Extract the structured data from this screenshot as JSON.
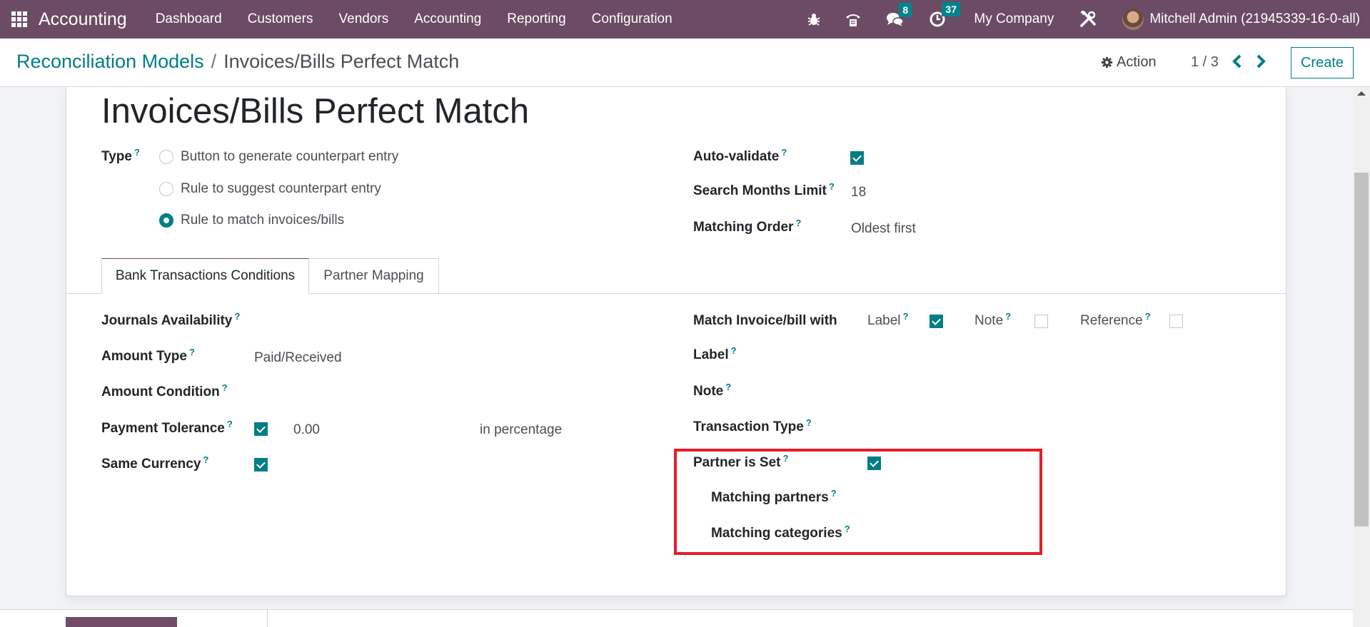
{
  "navbar": {
    "app_name": "Accounting",
    "menu": [
      "Dashboard",
      "Customers",
      "Vendors",
      "Accounting",
      "Reporting",
      "Configuration"
    ],
    "messages_count": "8",
    "activities_count": "37",
    "company": "My Company",
    "user": "Mitchell Admin (21945339-16-0-all)",
    "icons": [
      "apps-icon",
      "debug-icon",
      "phone-icon",
      "chat-icon",
      "clock-icon",
      "tools-icon"
    ]
  },
  "control_panel": {
    "breadcrumb_parent": "Reconciliation Models",
    "breadcrumb_separator": "/",
    "breadcrumb_current": "Invoices/Bills Perfect Match",
    "action_label": "Action",
    "pager": "1 / 3",
    "create_label": "Create"
  },
  "form": {
    "title": "Invoices/Bills Perfect Match",
    "help_mark": "?",
    "type": {
      "label": "Type",
      "options": [
        {
          "label": "Button to generate counterpart entry",
          "checked": false
        },
        {
          "label": "Rule to suggest counterpart entry",
          "checked": false
        },
        {
          "label": "Rule to match invoices/bills",
          "checked": true
        }
      ]
    },
    "auto_validate": {
      "label": "Auto-validate",
      "checked": true
    },
    "search_months_limit": {
      "label": "Search Months Limit",
      "value": "18"
    },
    "matching_order": {
      "label": "Matching Order",
      "value": "Oldest first"
    },
    "tabs": [
      {
        "label": "Bank Transactions Conditions",
        "active": true
      },
      {
        "label": "Partner Mapping",
        "active": false
      }
    ],
    "conditions": {
      "journals_availability": {
        "label": "Journals Availability",
        "value": ""
      },
      "amount_type": {
        "label": "Amount Type",
        "value": "Paid/Received"
      },
      "amount_condition": {
        "label": "Amount Condition",
        "value": ""
      },
      "payment_tolerance": {
        "label": "Payment Tolerance",
        "checked": true,
        "value": "0.00",
        "unit": "in percentage"
      },
      "same_currency": {
        "label": "Same Currency",
        "checked": true
      },
      "match_with": {
        "label": "Match Invoice/bill with",
        "options": [
          {
            "label": "Label",
            "checked": true
          },
          {
            "label": "Note",
            "checked": false
          },
          {
            "label": "Reference",
            "checked": false
          }
        ]
      },
      "label_field": {
        "label": "Label",
        "value": ""
      },
      "note_field": {
        "label": "Note",
        "value": ""
      },
      "transaction_type": {
        "label": "Transaction Type",
        "value": ""
      },
      "partner_is_set": {
        "label": "Partner is Set",
        "checked": true
      },
      "matching_partners": {
        "label": "Matching partners",
        "value": ""
      },
      "matching_categories": {
        "label": "Matching categories",
        "value": ""
      }
    }
  },
  "colors": {
    "navbar": "#6c4b64",
    "accent": "#017e84",
    "badge": "#00838f",
    "highlight": "#e41e26"
  }
}
